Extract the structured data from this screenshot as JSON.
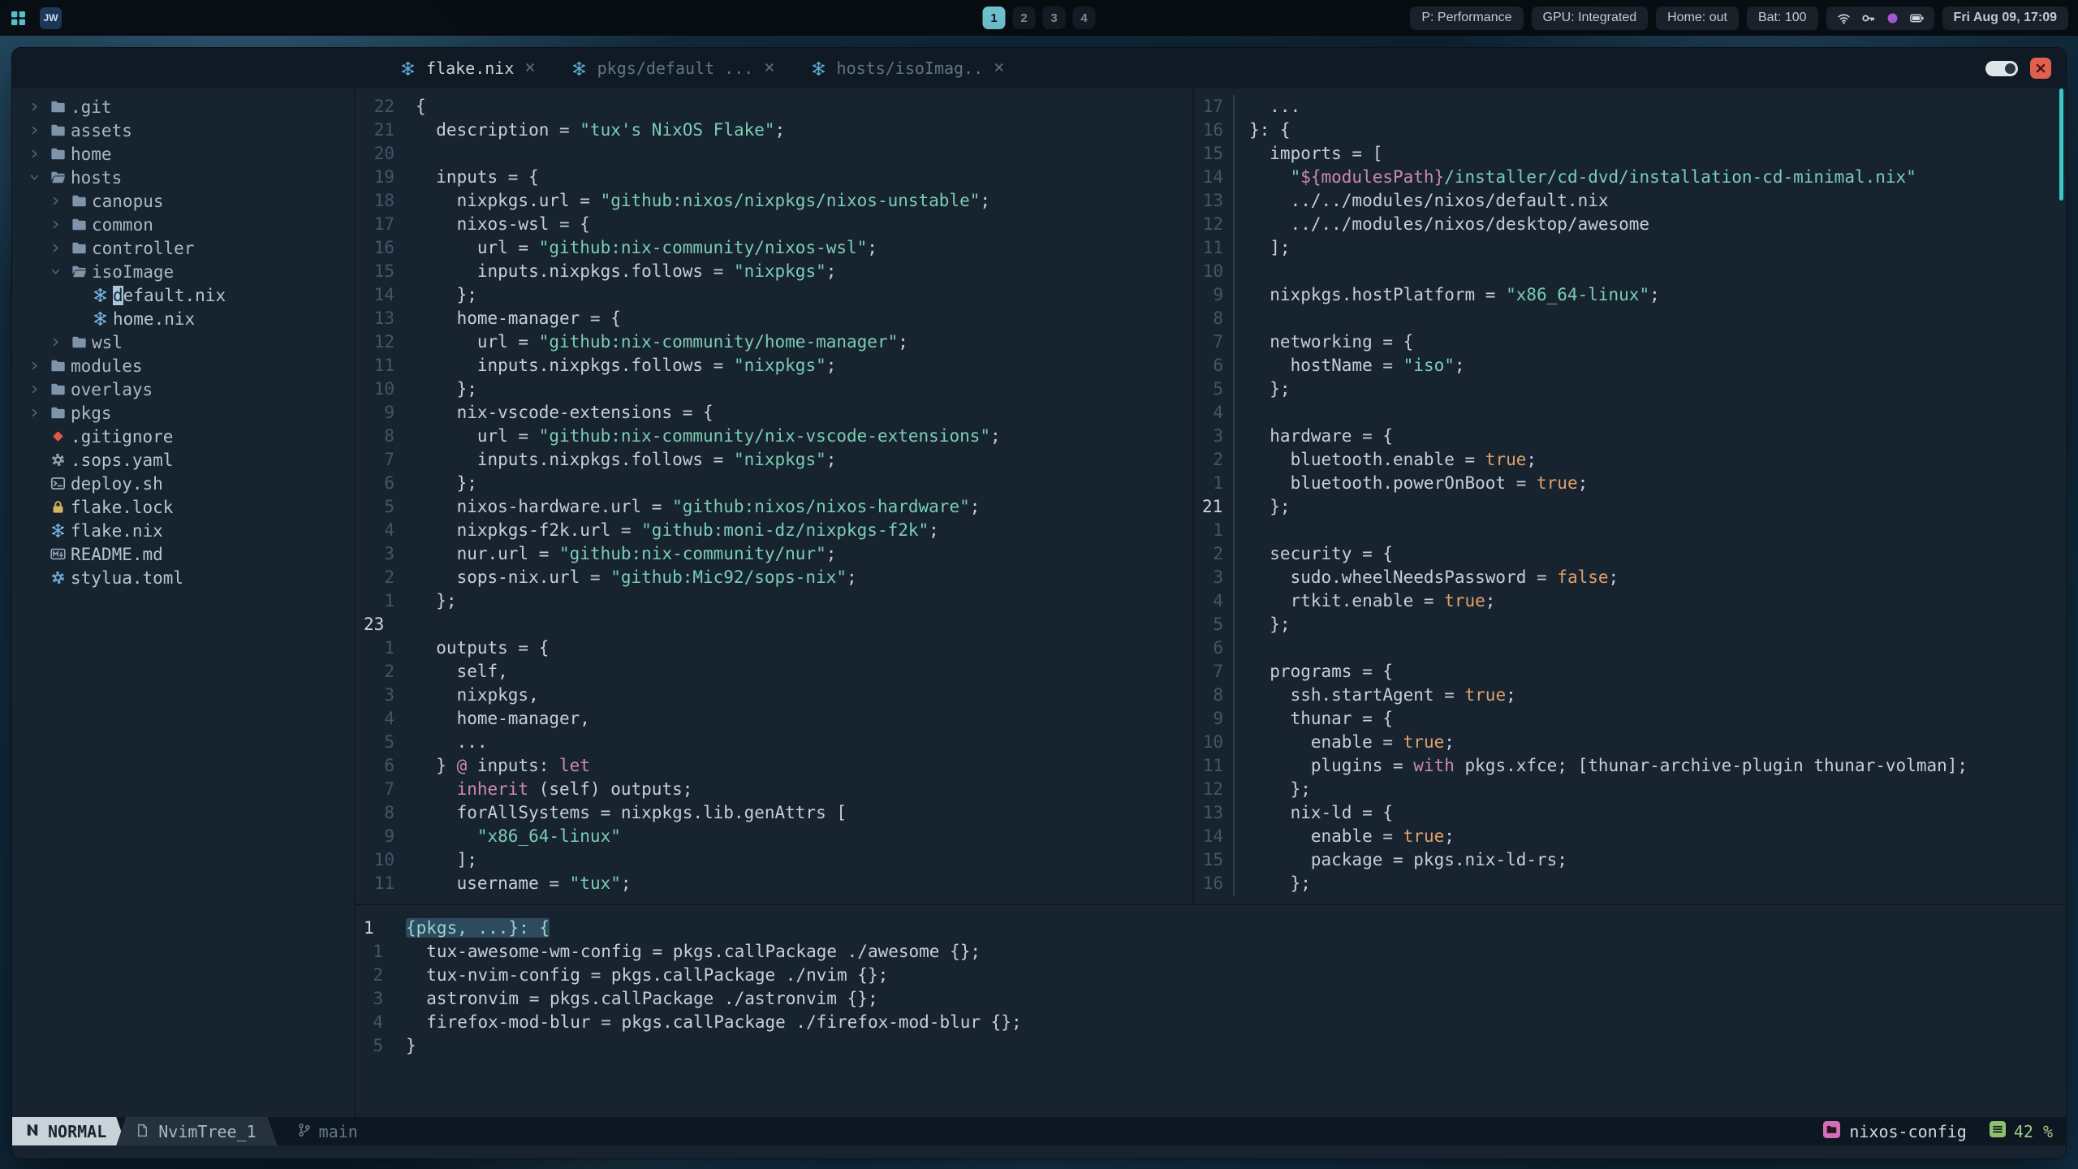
{
  "colors": {
    "accent_teal": "#6fc3cf",
    "string_teal": "#7bccb4",
    "boolean_orange": "#e0a06a",
    "keyword_pink": "#cf87b2",
    "close_button_red": "#e0604f",
    "project_pink": "#d170b8",
    "scroll_green": "#8fbf6f",
    "nix_blue": "#79b7e3"
  },
  "topbar": {
    "app_launcher_icon": "apps-grid-icon",
    "app_badge": "JW",
    "workspaces": [
      "1",
      "2",
      "3",
      "4"
    ],
    "active_workspace": "1",
    "pills": [
      "P: Performance",
      "GPU: Integrated",
      "Home: out",
      "Bat: 100"
    ],
    "tray_icons": [
      "wifi-icon",
      "key-icon",
      "vpn-dot-icon",
      "battery-icon"
    ],
    "clock": "Fri Aug 09, 17:09"
  },
  "window": {
    "tabs": [
      {
        "label": "flake.nix",
        "icon": "nix-snowflake-icon",
        "active": true
      },
      {
        "label": "pkgs/default ...",
        "icon": "nix-snowflake-icon",
        "active": false
      },
      {
        "label": "hosts/isoImag..",
        "icon": "nix-snowflake-icon",
        "active": false
      }
    ],
    "tab_close": "×",
    "close_label": "×"
  },
  "tree": {
    "items": [
      {
        "indent": 0,
        "chev": "closed",
        "icon": "folder",
        "label": ".git",
        "kind": "dir"
      },
      {
        "indent": 0,
        "chev": "closed",
        "icon": "folder",
        "label": "assets",
        "kind": "dir"
      },
      {
        "indent": 0,
        "chev": "closed",
        "icon": "folder",
        "label": "home",
        "kind": "dir"
      },
      {
        "indent": 0,
        "chev": "open",
        "icon": "folder-open",
        "label": "hosts",
        "kind": "dir"
      },
      {
        "indent": 1,
        "chev": "closed",
        "icon": "folder",
        "label": "canopus",
        "kind": "dir"
      },
      {
        "indent": 1,
        "chev": "closed",
        "icon": "folder",
        "label": "common",
        "kind": "dir"
      },
      {
        "indent": 1,
        "chev": "closed",
        "icon": "folder",
        "label": "controller",
        "kind": "dir"
      },
      {
        "indent": 1,
        "chev": "open",
        "icon": "folder-open",
        "label": "isoImage",
        "kind": "dir"
      },
      {
        "indent": 2,
        "icon": "nix",
        "label": "default.nix",
        "kind": "file",
        "cursor": 0
      },
      {
        "indent": 2,
        "icon": "nix",
        "label": "home.nix",
        "kind": "file"
      },
      {
        "indent": 1,
        "chev": "closed",
        "icon": "folder",
        "label": "wsl",
        "kind": "dir"
      },
      {
        "indent": 0,
        "chev": "closed",
        "icon": "folder",
        "label": "modules",
        "kind": "dir"
      },
      {
        "indent": 0,
        "chev": "closed",
        "icon": "folder",
        "label": "overlays",
        "kind": "dir"
      },
      {
        "indent": 0,
        "chev": "closed",
        "icon": "folder",
        "label": "pkgs",
        "kind": "dir"
      },
      {
        "indent": 0,
        "icon": "git",
        "label": ".gitignore",
        "kind": "file"
      },
      {
        "indent": 0,
        "icon": "gear",
        "label": ".sops.yaml",
        "kind": "file"
      },
      {
        "indent": 0,
        "icon": "shell",
        "label": "deploy.sh",
        "kind": "file"
      },
      {
        "indent": 0,
        "icon": "lock",
        "label": "flake.lock",
        "kind": "file"
      },
      {
        "indent": 0,
        "icon": "nix",
        "label": "flake.nix",
        "kind": "file"
      },
      {
        "indent": 0,
        "icon": "markdown",
        "label": "README.md",
        "kind": "file"
      },
      {
        "indent": 0,
        "icon": "toml",
        "label": "stylua.toml",
        "kind": "file"
      }
    ]
  },
  "editors": {
    "flake": [
      {
        "n": "22",
        "segs": [
          [
            "d",
            "{"
          ]
        ]
      },
      {
        "n": "21",
        "segs": [
          [
            "d",
            "  description = "
          ],
          [
            "s",
            "\"tux's NixOS Flake\""
          ],
          [
            "d",
            ";"
          ]
        ]
      },
      {
        "n": "20",
        "segs": []
      },
      {
        "n": "19",
        "segs": [
          [
            "d",
            "  inputs = {"
          ]
        ]
      },
      {
        "n": "18",
        "segs": [
          [
            "d",
            "    nixpkgs.url = "
          ],
          [
            "s",
            "\"github:nixos/nixpkgs/nixos-unstable\""
          ],
          [
            "d",
            ";"
          ]
        ]
      },
      {
        "n": "17",
        "segs": [
          [
            "d",
            "    nixos-wsl = {"
          ]
        ]
      },
      {
        "n": "16",
        "segs": [
          [
            "d",
            "      url = "
          ],
          [
            "s",
            "\"github:nix-community/nixos-wsl\""
          ],
          [
            "d",
            ";"
          ]
        ]
      },
      {
        "n": "15",
        "segs": [
          [
            "d",
            "      inputs.nixpkgs.follows = "
          ],
          [
            "s",
            "\"nixpkgs\""
          ],
          [
            "d",
            ";"
          ]
        ]
      },
      {
        "n": "14",
        "segs": [
          [
            "d",
            "    };"
          ]
        ]
      },
      {
        "n": "13",
        "segs": [
          [
            "d",
            "    home-manager = {"
          ]
        ]
      },
      {
        "n": "12",
        "segs": [
          [
            "d",
            "      url = "
          ],
          [
            "s",
            "\"github:nix-community/home-manager\""
          ],
          [
            "d",
            ";"
          ]
        ]
      },
      {
        "n": "11",
        "segs": [
          [
            "d",
            "      inputs.nixpkgs.follows = "
          ],
          [
            "s",
            "\"nixpkgs\""
          ],
          [
            "d",
            ";"
          ]
        ]
      },
      {
        "n": "10",
        "segs": [
          [
            "d",
            "    };"
          ]
        ]
      },
      {
        "n": "9",
        "segs": [
          [
            "d",
            "    nix-vscode-extensions = {"
          ]
        ]
      },
      {
        "n": "8",
        "segs": [
          [
            "d",
            "      url = "
          ],
          [
            "s",
            "\"github:nix-community/nix-vscode-extensions\""
          ],
          [
            "d",
            ";"
          ]
        ]
      },
      {
        "n": "7",
        "segs": [
          [
            "d",
            "      inputs.nixpkgs.follows = "
          ],
          [
            "s",
            "\"nixpkgs\""
          ],
          [
            "d",
            ";"
          ]
        ]
      },
      {
        "n": "6",
        "segs": [
          [
            "d",
            "    };"
          ]
        ]
      },
      {
        "n": "5",
        "segs": [
          [
            "d",
            "    nixos-hardware.url = "
          ],
          [
            "s",
            "\"github:nixos/nixos-hardware\""
          ],
          [
            "d",
            ";"
          ]
        ]
      },
      {
        "n": "4",
        "segs": [
          [
            "d",
            "    nixpkgs-f2k.url = "
          ],
          [
            "s",
            "\"github:moni-dz/nixpkgs-f2k\""
          ],
          [
            "d",
            ";"
          ]
        ]
      },
      {
        "n": "3",
        "segs": [
          [
            "d",
            "    nur.url = "
          ],
          [
            "s",
            "\"github:nix-community/nur\""
          ],
          [
            "d",
            ";"
          ]
        ]
      },
      {
        "n": "2",
        "segs": [
          [
            "d",
            "    sops-nix.url = "
          ],
          [
            "s",
            "\"github:Mic92/sops-nix\""
          ],
          [
            "d",
            ";"
          ]
        ]
      },
      {
        "n": "1",
        "segs": [
          [
            "d",
            "  };"
          ]
        ]
      },
      {
        "n": "23",
        "cur": true,
        "segs": []
      },
      {
        "n": "1",
        "segs": [
          [
            "d",
            "  outputs = {"
          ]
        ]
      },
      {
        "n": "2",
        "segs": [
          [
            "d",
            "    self,"
          ]
        ]
      },
      {
        "n": "3",
        "segs": [
          [
            "d",
            "    nixpkgs,"
          ]
        ]
      },
      {
        "n": "4",
        "segs": [
          [
            "d",
            "    home-manager,"
          ]
        ]
      },
      {
        "n": "5",
        "segs": [
          [
            "d",
            "    ..."
          ]
        ]
      },
      {
        "n": "6",
        "segs": [
          [
            "d",
            "  } "
          ],
          [
            "k",
            "@"
          ],
          [
            "d",
            " inputs: "
          ],
          [
            "k",
            "let"
          ]
        ]
      },
      {
        "n": "7",
        "segs": [
          [
            "k",
            "    inherit"
          ],
          [
            "d",
            " (self) outputs;"
          ]
        ]
      },
      {
        "n": "8",
        "segs": [
          [
            "d",
            "    forAllSystems = nixpkgs.lib.genAttrs ["
          ]
        ]
      },
      {
        "n": "9",
        "segs": [
          [
            "s",
            "      \"x86_64-linux\""
          ]
        ]
      },
      {
        "n": "10",
        "segs": [
          [
            "d",
            "    ];"
          ]
        ]
      },
      {
        "n": "11",
        "segs": [
          [
            "d",
            "    username = "
          ],
          [
            "s",
            "\"tux\""
          ],
          [
            "d",
            ";"
          ]
        ]
      }
    ],
    "iso": [
      {
        "n": "17",
        "segs": [
          [
            "d",
            "  ..."
          ]
        ]
      },
      {
        "n": "16",
        "segs": [
          [
            "d",
            "}: {"
          ]
        ]
      },
      {
        "n": "15",
        "segs": [
          [
            "d",
            "  imports = ["
          ]
        ]
      },
      {
        "n": "14",
        "segs": [
          [
            "s",
            "    \""
          ],
          [
            "i",
            "${modulesPath}"
          ],
          [
            "s",
            "/installer/cd-dvd/installation-cd-minimal.nix\""
          ]
        ]
      },
      {
        "n": "13",
        "segs": [
          [
            "d",
            "    ../../modules/nixos/default.nix"
          ]
        ]
      },
      {
        "n": "12",
        "segs": [
          [
            "d",
            "    ../../modules/nixos/desktop/awesome"
          ]
        ]
      },
      {
        "n": "11",
        "segs": [
          [
            "d",
            "  ];"
          ]
        ]
      },
      {
        "n": "10",
        "segs": []
      },
      {
        "n": "9",
        "segs": [
          [
            "d",
            "  nixpkgs.hostPlatform = "
          ],
          [
            "s",
            "\"x86_64-linux\""
          ],
          [
            "d",
            ";"
          ]
        ]
      },
      {
        "n": "8",
        "segs": []
      },
      {
        "n": "7",
        "segs": [
          [
            "d",
            "  networking = {"
          ]
        ]
      },
      {
        "n": "6",
        "segs": [
          [
            "d",
            "    hostName = "
          ],
          [
            "s",
            "\"iso\""
          ],
          [
            "d",
            ";"
          ]
        ]
      },
      {
        "n": "5",
        "segs": [
          [
            "d",
            "  };"
          ]
        ]
      },
      {
        "n": "4",
        "segs": []
      },
      {
        "n": "3",
        "segs": [
          [
            "d",
            "  hardware = {"
          ]
        ]
      },
      {
        "n": "2",
        "segs": [
          [
            "d",
            "    bluetooth.enable = "
          ],
          [
            "b",
            "true"
          ],
          [
            "d",
            ";"
          ]
        ]
      },
      {
        "n": "1",
        "segs": [
          [
            "d",
            "    bluetooth.powerOnBoot = "
          ],
          [
            "b",
            "true"
          ],
          [
            "d",
            ";"
          ]
        ]
      },
      {
        "n": "21",
        "cur": true,
        "segs": [
          [
            "d",
            "  };"
          ]
        ]
      },
      {
        "n": "1",
        "segs": []
      },
      {
        "n": "2",
        "segs": [
          [
            "d",
            "  security = {"
          ]
        ]
      },
      {
        "n": "3",
        "segs": [
          [
            "d",
            "    sudo.wheelNeedsPassword = "
          ],
          [
            "b",
            "false"
          ],
          [
            "d",
            ";"
          ]
        ]
      },
      {
        "n": "4",
        "segs": [
          [
            "d",
            "    rtkit.enable = "
          ],
          [
            "b",
            "true"
          ],
          [
            "d",
            ";"
          ]
        ]
      },
      {
        "n": "5",
        "segs": [
          [
            "d",
            "  };"
          ]
        ]
      },
      {
        "n": "6",
        "segs": []
      },
      {
        "n": "7",
        "segs": [
          [
            "d",
            "  programs = {"
          ]
        ]
      },
      {
        "n": "8",
        "segs": [
          [
            "d",
            "    ssh.startAgent = "
          ],
          [
            "b",
            "true"
          ],
          [
            "d",
            ";"
          ]
        ]
      },
      {
        "n": "9",
        "segs": [
          [
            "d",
            "    thunar = {"
          ]
        ]
      },
      {
        "n": "10",
        "segs": [
          [
            "d",
            "      enable = "
          ],
          [
            "b",
            "true"
          ],
          [
            "d",
            ";"
          ]
        ]
      },
      {
        "n": "11",
        "segs": [
          [
            "d",
            "      plugins = "
          ],
          [
            "k",
            "with"
          ],
          [
            "d",
            " pkgs.xfce; [thunar-archive-plugin thunar-volman];"
          ]
        ]
      },
      {
        "n": "12",
        "segs": [
          [
            "d",
            "    };"
          ]
        ]
      },
      {
        "n": "13",
        "segs": [
          [
            "d",
            "    nix-ld = {"
          ]
        ]
      },
      {
        "n": "14",
        "segs": [
          [
            "d",
            "      enable = "
          ],
          [
            "b",
            "true"
          ],
          [
            "d",
            ";"
          ]
        ]
      },
      {
        "n": "15",
        "segs": [
          [
            "d",
            "      package = pkgs.nix-ld-rs;"
          ]
        ]
      },
      {
        "n": "16",
        "segs": [
          [
            "d",
            "    };"
          ]
        ]
      }
    ],
    "pkgs": [
      {
        "n": "1",
        "cur": true,
        "segs": [
          [
            "sel",
            "{pkgs, ...}: {"
          ]
        ]
      },
      {
        "n": "1",
        "segs": [
          [
            "d",
            "  tux-awesome-wm-config = pkgs.callPackage ./awesome {};"
          ]
        ]
      },
      {
        "n": "2",
        "segs": [
          [
            "d",
            "  tux-nvim-config = pkgs.callPackage ./nvim {};"
          ]
        ]
      },
      {
        "n": "3",
        "segs": [
          [
            "d",
            "  astronvim = pkgs.callPackage ./astronvim {};"
          ]
        ]
      },
      {
        "n": "4",
        "segs": [
          [
            "d",
            "  firefox-mod-blur = pkgs.callPackage ./firefox-mod-blur {};"
          ]
        ]
      },
      {
        "n": "5",
        "segs": [
          [
            "d",
            "}"
          ]
        ]
      }
    ]
  },
  "statusline": {
    "mode": "NORMAL",
    "buffer": "NvimTree_1",
    "branch": "main",
    "project": "nixos-config",
    "scroll_pct": "42 %"
  }
}
